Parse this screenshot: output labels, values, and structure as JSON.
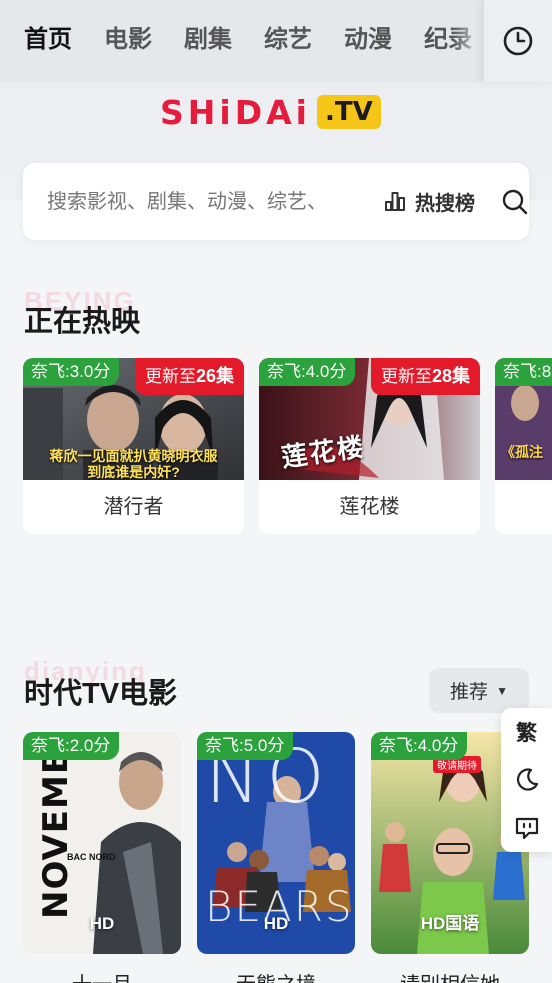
{
  "nav": {
    "tabs": [
      "首页",
      "电影",
      "剧集",
      "综艺",
      "动漫",
      "纪录"
    ],
    "active_index": 0
  },
  "logo": {
    "text": "SHiDAi",
    "badge": ".TV"
  },
  "search": {
    "placeholder": "搜索影视、剧集、动漫、综艺、",
    "hot_label": "热搜榜"
  },
  "now_showing": {
    "ghost_text": "BEYING",
    "title": "正在热映",
    "items": [
      {
        "score": "奈飞:3.0分",
        "update": "更新至",
        "update_count": "26集",
        "title": "潜行者",
        "caption_line1": "蒋欣一见面就扒黄晓明衣服",
        "caption_line2": "到底谁是内奸?"
      },
      {
        "score": "奈飞:4.0分",
        "update": "更新至",
        "update_count": "28集",
        "title": "莲花楼",
        "poster_text": "莲花楼"
      },
      {
        "score": "奈飞:8",
        "title": "",
        "caption": "《孤注"
      }
    ]
  },
  "movies": {
    "ghost_text": "dianying",
    "title": "时代TV电影",
    "sort_label": "推荐",
    "items": [
      {
        "score": "奈飞:2.0分",
        "quality": "HD",
        "title": "十一月",
        "poster_text": "NOVEMBRE",
        "poster_sub": "BAC NORD"
      },
      {
        "score": "奈飞:5.0分",
        "quality": "HD",
        "title": "无熊之境",
        "poster_text_1": "NO",
        "poster_text_2": "BEARS"
      },
      {
        "score": "奈飞:4.0分",
        "quality": "HD国语",
        "title": "请别相信她",
        "poster_tag": "敬请期待"
      }
    ]
  },
  "float_tools": {
    "traditional_label": "繁"
  },
  "colors": {
    "accent": "#f5c518",
    "brand_red": "#e51c3c",
    "score_green": "#2ca23d",
    "update_red": "#e31a2a"
  }
}
